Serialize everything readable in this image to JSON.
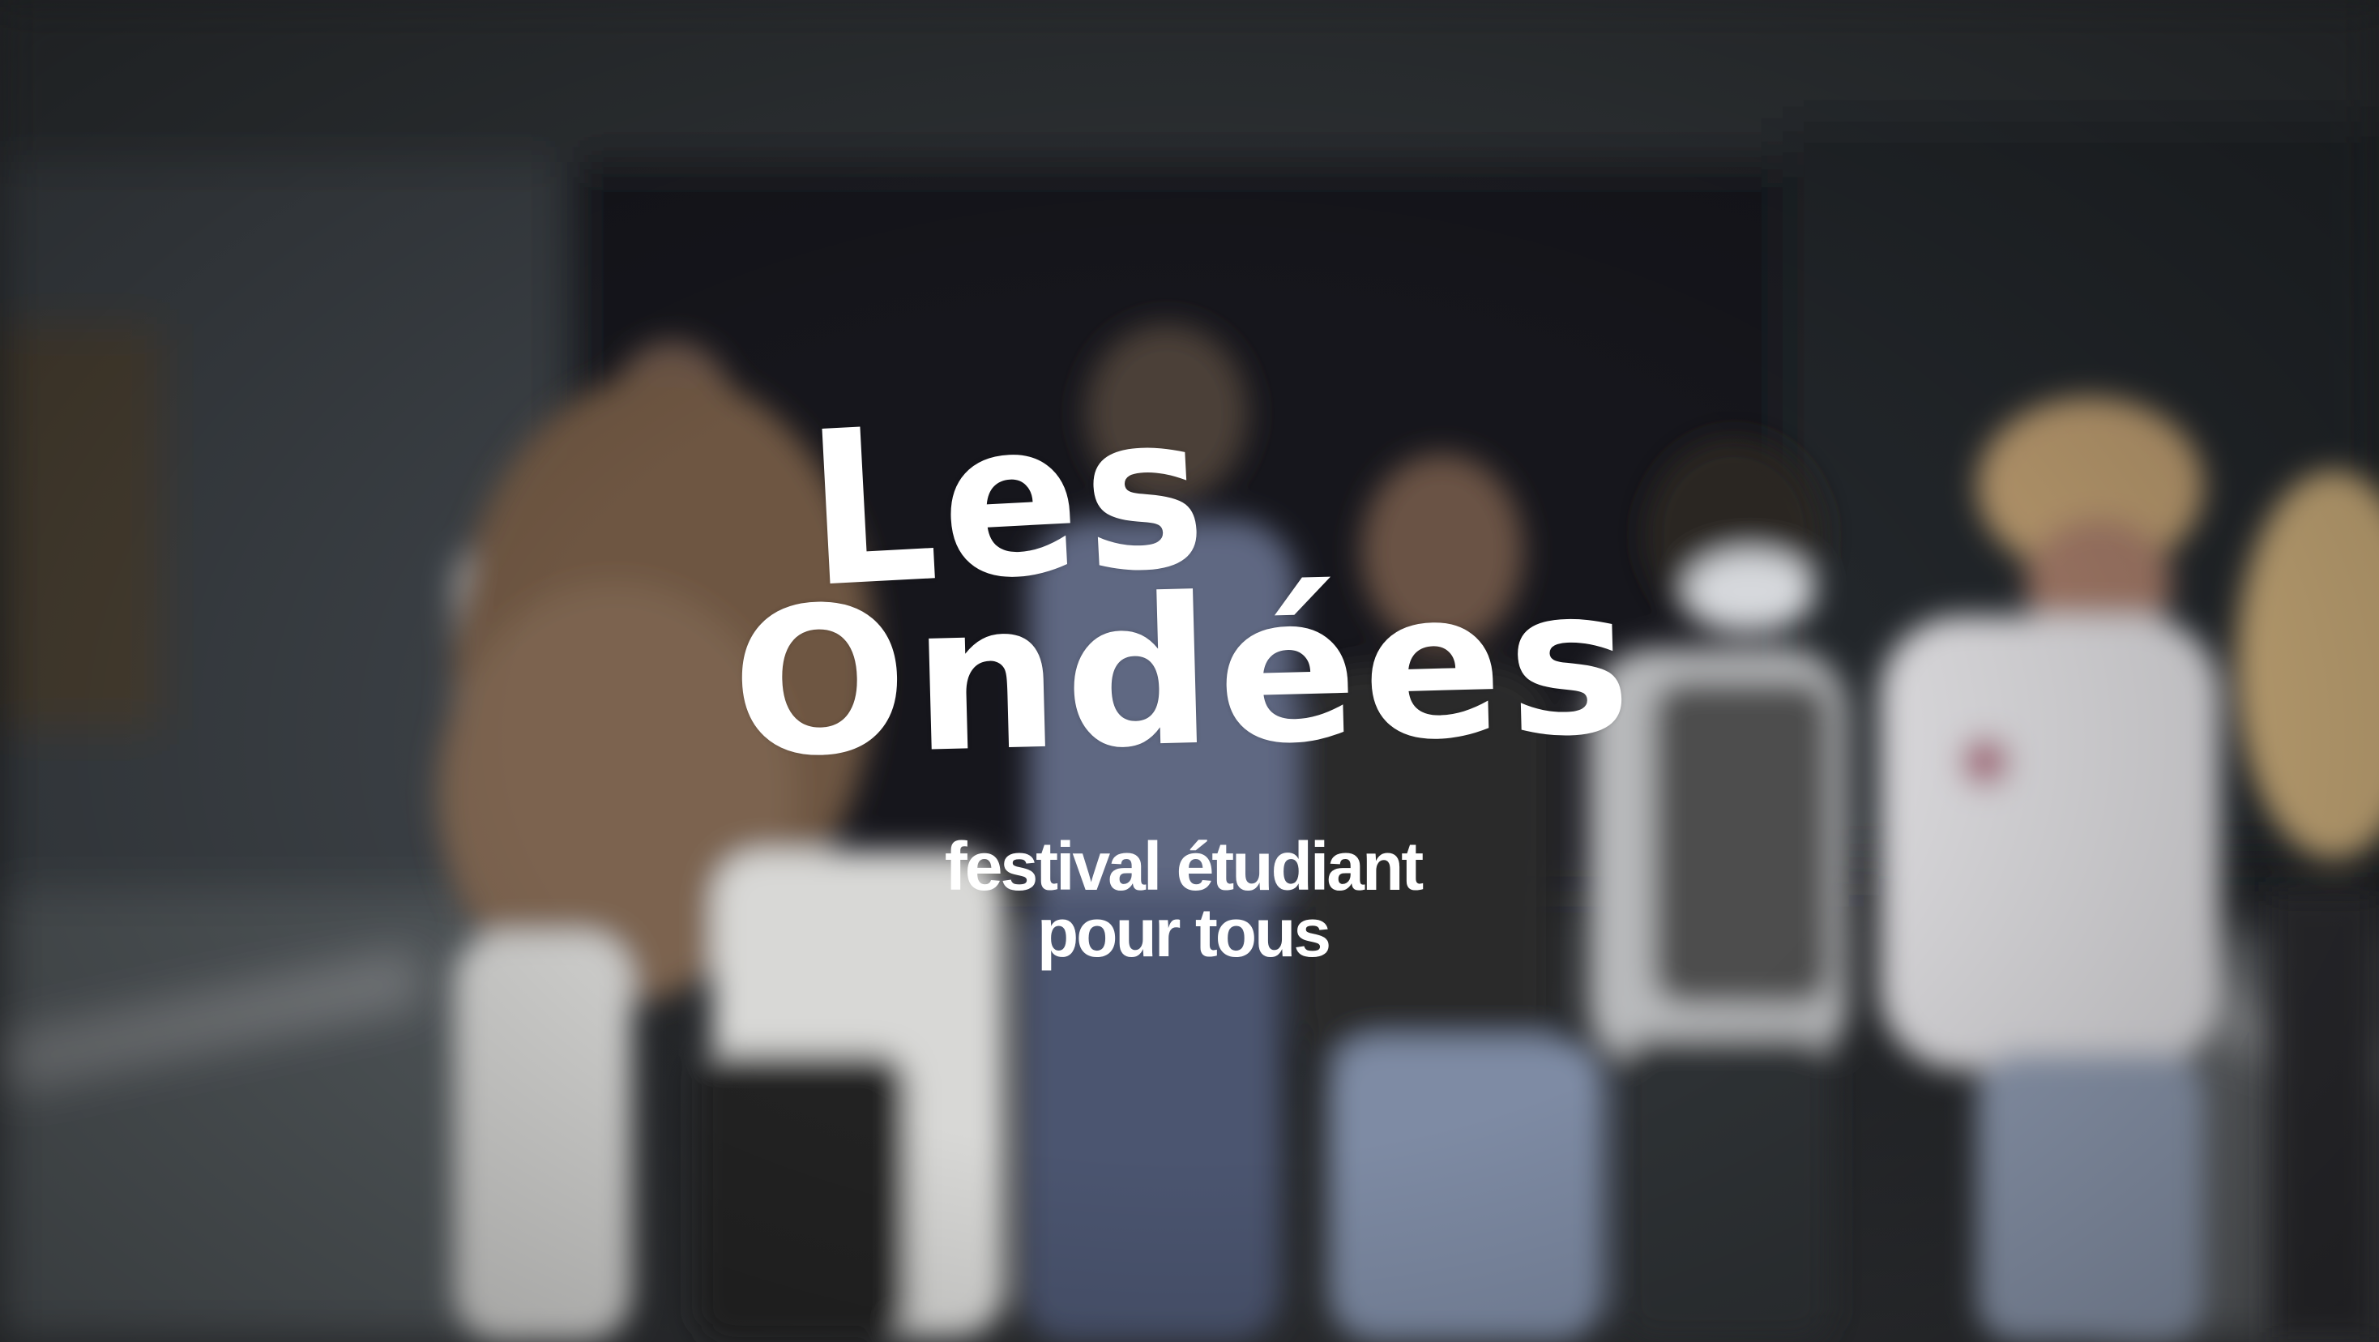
{
  "logo": {
    "line1": "Les",
    "line2": "Ondées"
  },
  "tagline": {
    "line1": "festival étudiant",
    "line2": "pour tous"
  },
  "colors": {
    "text": "#ffffff",
    "background_dark": "#1a1c1e",
    "background_mid": "#3a3f44"
  }
}
